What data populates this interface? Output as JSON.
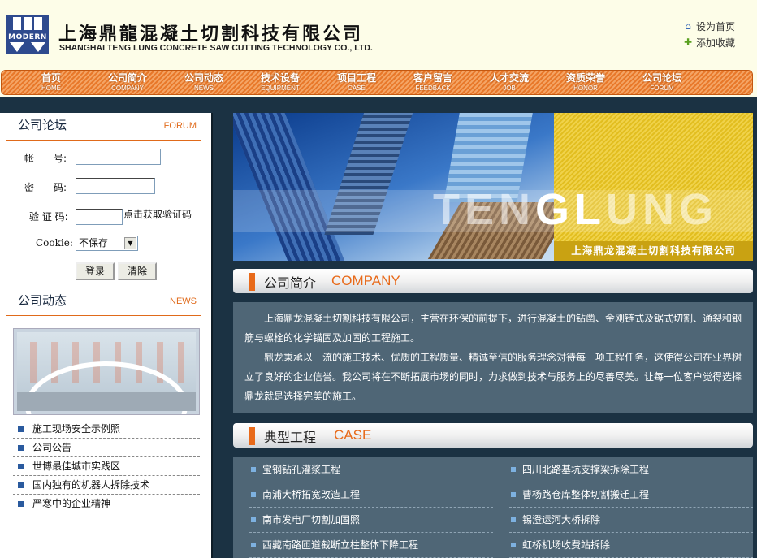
{
  "header": {
    "logo_text": "MODERN",
    "company_cn": "上海鼎龍混凝土切割科技有限公司",
    "company_en": "SHANGHAI TENG LUNG CONCRETE SAW CUTTING TECHNOLOGY CO., LTD.",
    "links": [
      {
        "label": "设为首页",
        "icon": "home-icon"
      },
      {
        "label": "添加收藏",
        "icon": "bookmark-icon"
      }
    ]
  },
  "nav": [
    {
      "cn": "首页",
      "en": "HOME"
    },
    {
      "cn": "公司简介",
      "en": "COMPANY"
    },
    {
      "cn": "公司动态",
      "en": "NEWS"
    },
    {
      "cn": "技术设备",
      "en": "EQUIPMENT"
    },
    {
      "cn": "项目工程",
      "en": "CASE"
    },
    {
      "cn": "客户留言",
      "en": "FEEDBACK"
    },
    {
      "cn": "人才交流",
      "en": "JOB"
    },
    {
      "cn": "资质荣誉",
      "en": "HONOR"
    },
    {
      "cn": "公司论坛",
      "en": "FORUM"
    }
  ],
  "forum": {
    "title": "公司论坛",
    "title_en": "FORUM",
    "account_label": "帐　　号:",
    "password_label": "密　　码:",
    "captcha_label": "验 证 码:",
    "captcha_link": "点击获取验证码",
    "cookie_label": "Cookie:",
    "cookie_value": "不保存",
    "login_button": "登录",
    "clear_button": "清除"
  },
  "news": {
    "title": "公司动态",
    "title_en": "NEWS",
    "items": [
      "施工现场安全示例照",
      "公司公告",
      "世博最佳城市实践区",
      "国内独有的机器人拆除技术",
      "严寒中的企业精神"
    ]
  },
  "banner": {
    "text_faded": "TEN",
    "text_bold": "GL",
    "text_tail": "UNG",
    "caption": "上海鼎龙混凝土切割科技有限公司"
  },
  "company": {
    "title": "公司简介",
    "title_en": "COMPANY",
    "paragraphs": [
      "上海鼎龙混凝土切割科技有限公司，主营在环保的前提下，进行混凝土的钻凿、金刚链式及锯式切割、通裂和钢筋与螺栓的化学锚固及加固的工程施工。",
      "鼎龙秉承以一流的施工技术、优质的工程质量、精诚至信的服务理念对待每一项工程任务，这使得公司在业界树立了良好的企业信誉。我公司将在不断拓展市场的同时，力求做到技术与服务上的尽善尽美。让每一位客户觉得选择鼎龙就是选择完美的施工。"
    ]
  },
  "cases": {
    "title": "典型工程",
    "title_en": "CASE",
    "items": [
      "宝钢钻孔灌浆工程",
      "四川北路基坑支撑梁拆除工程",
      "南浦大桥拓宽改造工程",
      "曹杨路仓库整体切割搬迁工程",
      "南市发电厂切割加固照",
      "锡澄运河大桥拆除",
      "西藏南路匝道截断立柱整体下降工程",
      "虹桥机场收费站拆除"
    ]
  },
  "colors": {
    "accent": "#e86a1a",
    "nav_bg": "#f0904a",
    "panel": "#4f6676",
    "dark": "#1b3243"
  }
}
